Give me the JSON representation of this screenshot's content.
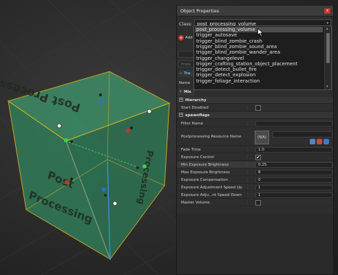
{
  "panel": {
    "title": "Object Properties",
    "close_glyph": "x",
    "class_label": "Class:",
    "class_value": "post_processing_volume",
    "class_dropdown_arrow": "▾"
  },
  "dropdown": {
    "items": [
      "post_processing_volume",
      "trigger_autosave",
      "trigger_blind_zombie_crash",
      "trigger_blind_zombie_sound_area",
      "trigger_blind_zombie_wander_area",
      "trigger_changelevel",
      "trigger_crafting_station_object_placement",
      "trigger_detect_bullet_fire",
      "trigger_detect_explosion",
      "trigger_foliage_interaction"
    ],
    "selected_index": 0,
    "scroll_up_glyph": "▴",
    "scroll_down_glyph": "▾"
  },
  "underlying": {
    "add_icon": "+",
    "add_label": "Add",
    "props_placeholder": "Prope",
    "section_a_toggle": "−",
    "section_a_label": "Tra",
    "name_label": "Name",
    "section_b_toggle": "+",
    "section_b_label": "Mis"
  },
  "grid": {
    "hierarchy": {
      "toggle": "+",
      "label": "Hierarchy"
    },
    "start_disabled": {
      "label": "Start Disabled",
      "checked": false
    },
    "spawnflags": {
      "toggle": "+",
      "label": "spawnflags"
    },
    "filter_name": {
      "label": "Filter Name",
      "value": ""
    },
    "pp_resource": {
      "label": "Postprocessing Resource Name",
      "thumb_text": "(N/A)",
      "value": ""
    },
    "fade_time": {
      "label": "Fade Time",
      "value": "1.0"
    },
    "exposure_control": {
      "label": "Exposure Control",
      "checked": true,
      "mark": "✔"
    },
    "min_exposure": {
      "label": "Min Exposure Brightness",
      "value": "0.25"
    },
    "max_exposure": {
      "label": "Max Exposure Brightness",
      "value": "8"
    },
    "exposure_comp": {
      "label": "Exposure Compensation",
      "value": "0"
    },
    "adj_speed_up": {
      "label": "Exposure Adjustment Speed Up",
      "value": "1"
    },
    "adj_speed_down": {
      "label": "Exposure Adju...nt Speed Down",
      "value": "1"
    },
    "master_volume": {
      "label": "Master Volume",
      "checked": false
    },
    "separator_glyph": "⋮"
  },
  "viewport": {
    "volume_text": "Post Processing",
    "volume_fill": "#2f7f5a",
    "edge_color": "#e8b820",
    "axis_blue": "#3a8ee0"
  },
  "icons": {
    "add": "add-icon",
    "close": "close-icon",
    "cursor": "mouse-cursor-icon",
    "browse": "browse-icon"
  }
}
